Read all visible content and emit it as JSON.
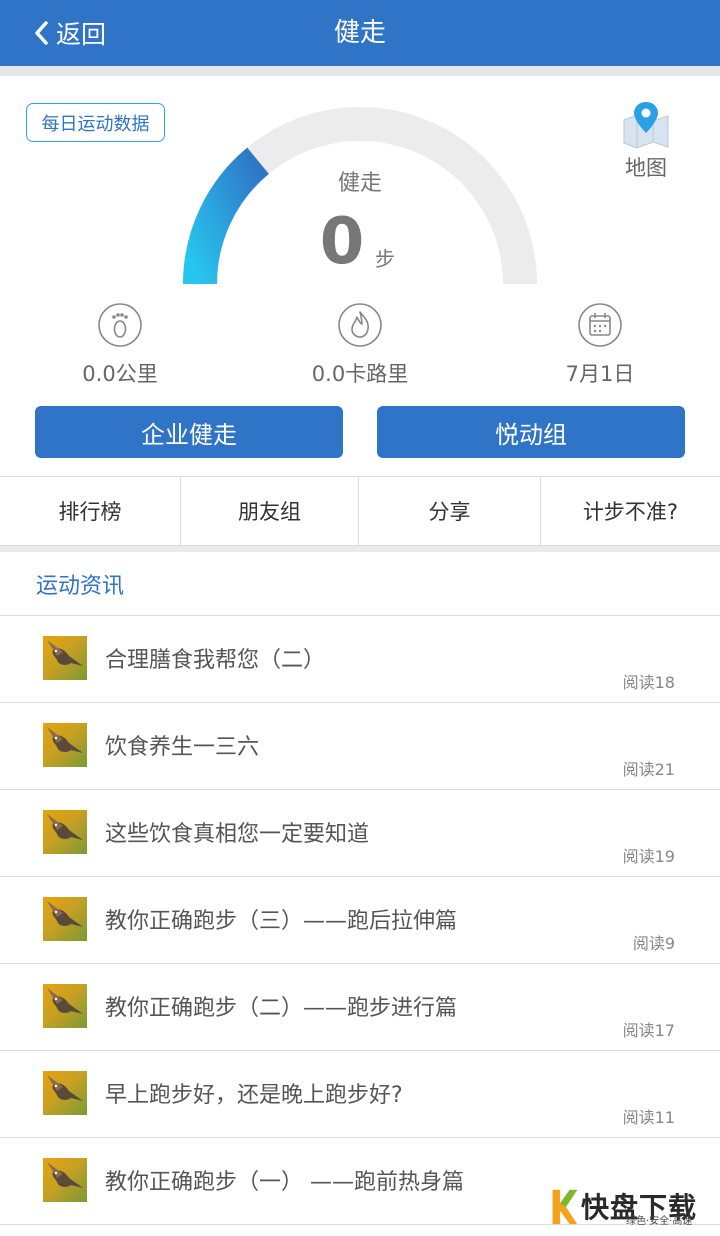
{
  "nav": {
    "back_label": "返回",
    "title": "健走"
  },
  "badge": {
    "label": "每日运动数据"
  },
  "map": {
    "label": "地图"
  },
  "gauge": {
    "label": "健走",
    "value": "0",
    "unit": "步",
    "progress": 0.28,
    "colors": {
      "start": "#27c6ee",
      "end": "#2f74c6",
      "track": "#ececec"
    }
  },
  "stats": [
    {
      "icon": "footprint-icon",
      "value": "0.0公里"
    },
    {
      "icon": "flame-icon",
      "value": "0.0卡路里"
    },
    {
      "icon": "calendar-icon",
      "value": "7月1日"
    }
  ],
  "buttons": {
    "enterprise": "企业健走",
    "group": "悦动组"
  },
  "tabs": [
    {
      "label": "排行榜"
    },
    {
      "label": "朋友组"
    },
    {
      "label": "分享"
    },
    {
      "label": "计步不准?"
    }
  ],
  "news": {
    "header": "运动资讯",
    "items": [
      {
        "title": "合理膳食我帮您（二）",
        "reads": "阅读18"
      },
      {
        "title": "饮食养生一三六",
        "reads": "阅读21"
      },
      {
        "title": "这些饮食真相您一定要知道",
        "reads": "阅读19"
      },
      {
        "title": "教你正确跑步（三）——跑后拉伸篇",
        "reads": "阅读9"
      },
      {
        "title": "教你正确跑步（二）——跑步进行篇",
        "reads": "阅读17"
      },
      {
        "title": "早上跑步好，还是晚上跑步好?",
        "reads": "阅读11"
      },
      {
        "title": "教你正确跑步（一） ——跑前热身篇",
        "reads": ""
      }
    ]
  },
  "watermark": {
    "logo_text": "快盘下载",
    "tagline": "绿色·安全·高速"
  },
  "colors": {
    "primary": "#2f74c6",
    "accent": "#2aa8e0"
  }
}
